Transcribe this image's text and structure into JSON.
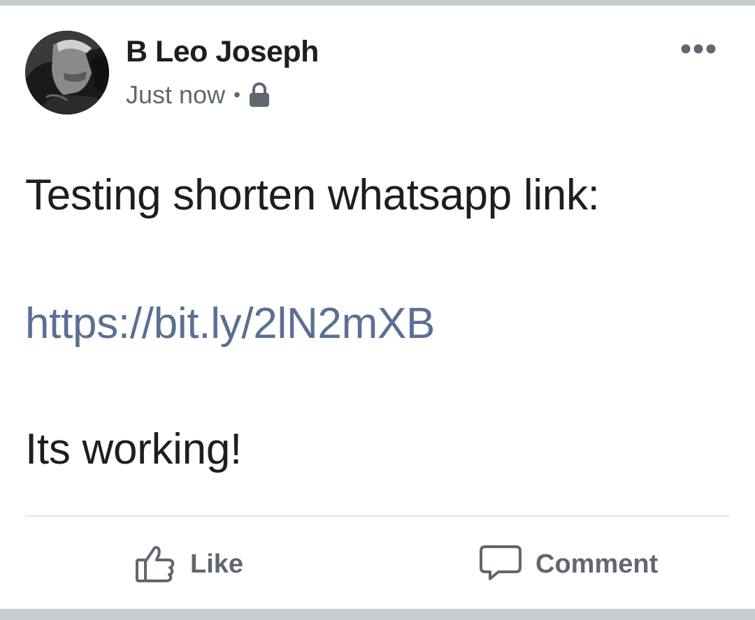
{
  "post": {
    "author": "B Leo Joseph",
    "timestamp": "Just now",
    "separator": "•",
    "privacy_icon": "lock-icon",
    "menu_icon": "more-options-icon",
    "text_line1": "Testing shorten whatsapp link:",
    "link": "https://bit.ly/2lN2mXB",
    "text_line3": "Its working!"
  },
  "actions": {
    "like_label": "Like",
    "like_icon": "thumbs-up-icon",
    "comment_label": "Comment",
    "comment_icon": "comment-bubble-icon"
  },
  "colors": {
    "text": "#1c1e21",
    "secondary": "#606770",
    "link": "#5b6f95",
    "band": "#c9ccd1",
    "divider": "#e4e6ea"
  }
}
